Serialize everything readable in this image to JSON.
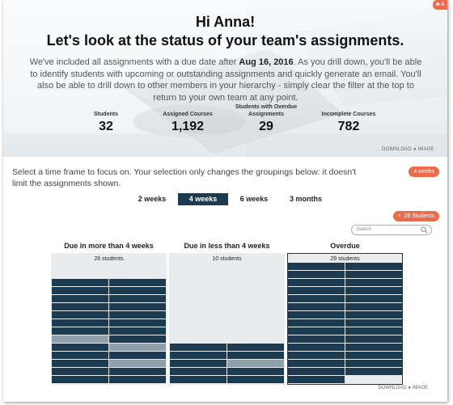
{
  "header": {
    "greeting": "Hi Anna!",
    "subtitle": "Let's look at the status of your team's assignments.",
    "intro_before": "We've included all assignments with a due date after ",
    "intro_date": "Aug 16, 2016",
    "intro_after": ". As you drill down, you'll be able to identify students with upcoming or outstanding assignments and quickly generate an email. You'll also be able to drill down to other members in your hierarchy - simply clear the filter at the top to return to your own team at any point.",
    "badge": "⊗ A"
  },
  "stats": [
    {
      "label": "Students",
      "value": "32"
    },
    {
      "label": "Assigned Courses",
      "value": "1,192"
    },
    {
      "label": "Students with Overdue Assignments",
      "value": "29"
    },
    {
      "label": "Incomplete Courses",
      "value": "782"
    }
  ],
  "download_top": {
    "download": "DOWNLOAD",
    "image": "IMAGE"
  },
  "timeframe": {
    "prompt": "Select a time frame to focus on. Your selection only changes the groupings below: it doesn't limit the assignments shown.",
    "selected_pill": "4 weeks",
    "tabs": [
      "2 weeks",
      "4 weeks",
      "6 weeks",
      "3 months"
    ],
    "active_tab": "4 weeks"
  },
  "filter_pill": {
    "close": "×",
    "label": "29 Students"
  },
  "search": {
    "placeholder": "Search"
  },
  "groups": [
    {
      "title": "Due in more than 4 weeks",
      "count_label": "26 students",
      "students": 26,
      "highlighted": [
        14,
        17,
        21
      ]
    },
    {
      "title": "Due in less than 4 weeks",
      "count_label": "10 students",
      "students": 10,
      "highlighted": [
        5
      ]
    },
    {
      "title": "Overdue",
      "count_label": "29 students",
      "students": 29,
      "highlighted": [],
      "selected": true
    }
  ],
  "download_bottom": {
    "download": "DOWNLOAD",
    "image": "IMAGE"
  },
  "colors": {
    "navy": "#1a3b52",
    "accent": "#ee6b4a",
    "highlight": "#8fa0ab"
  }
}
